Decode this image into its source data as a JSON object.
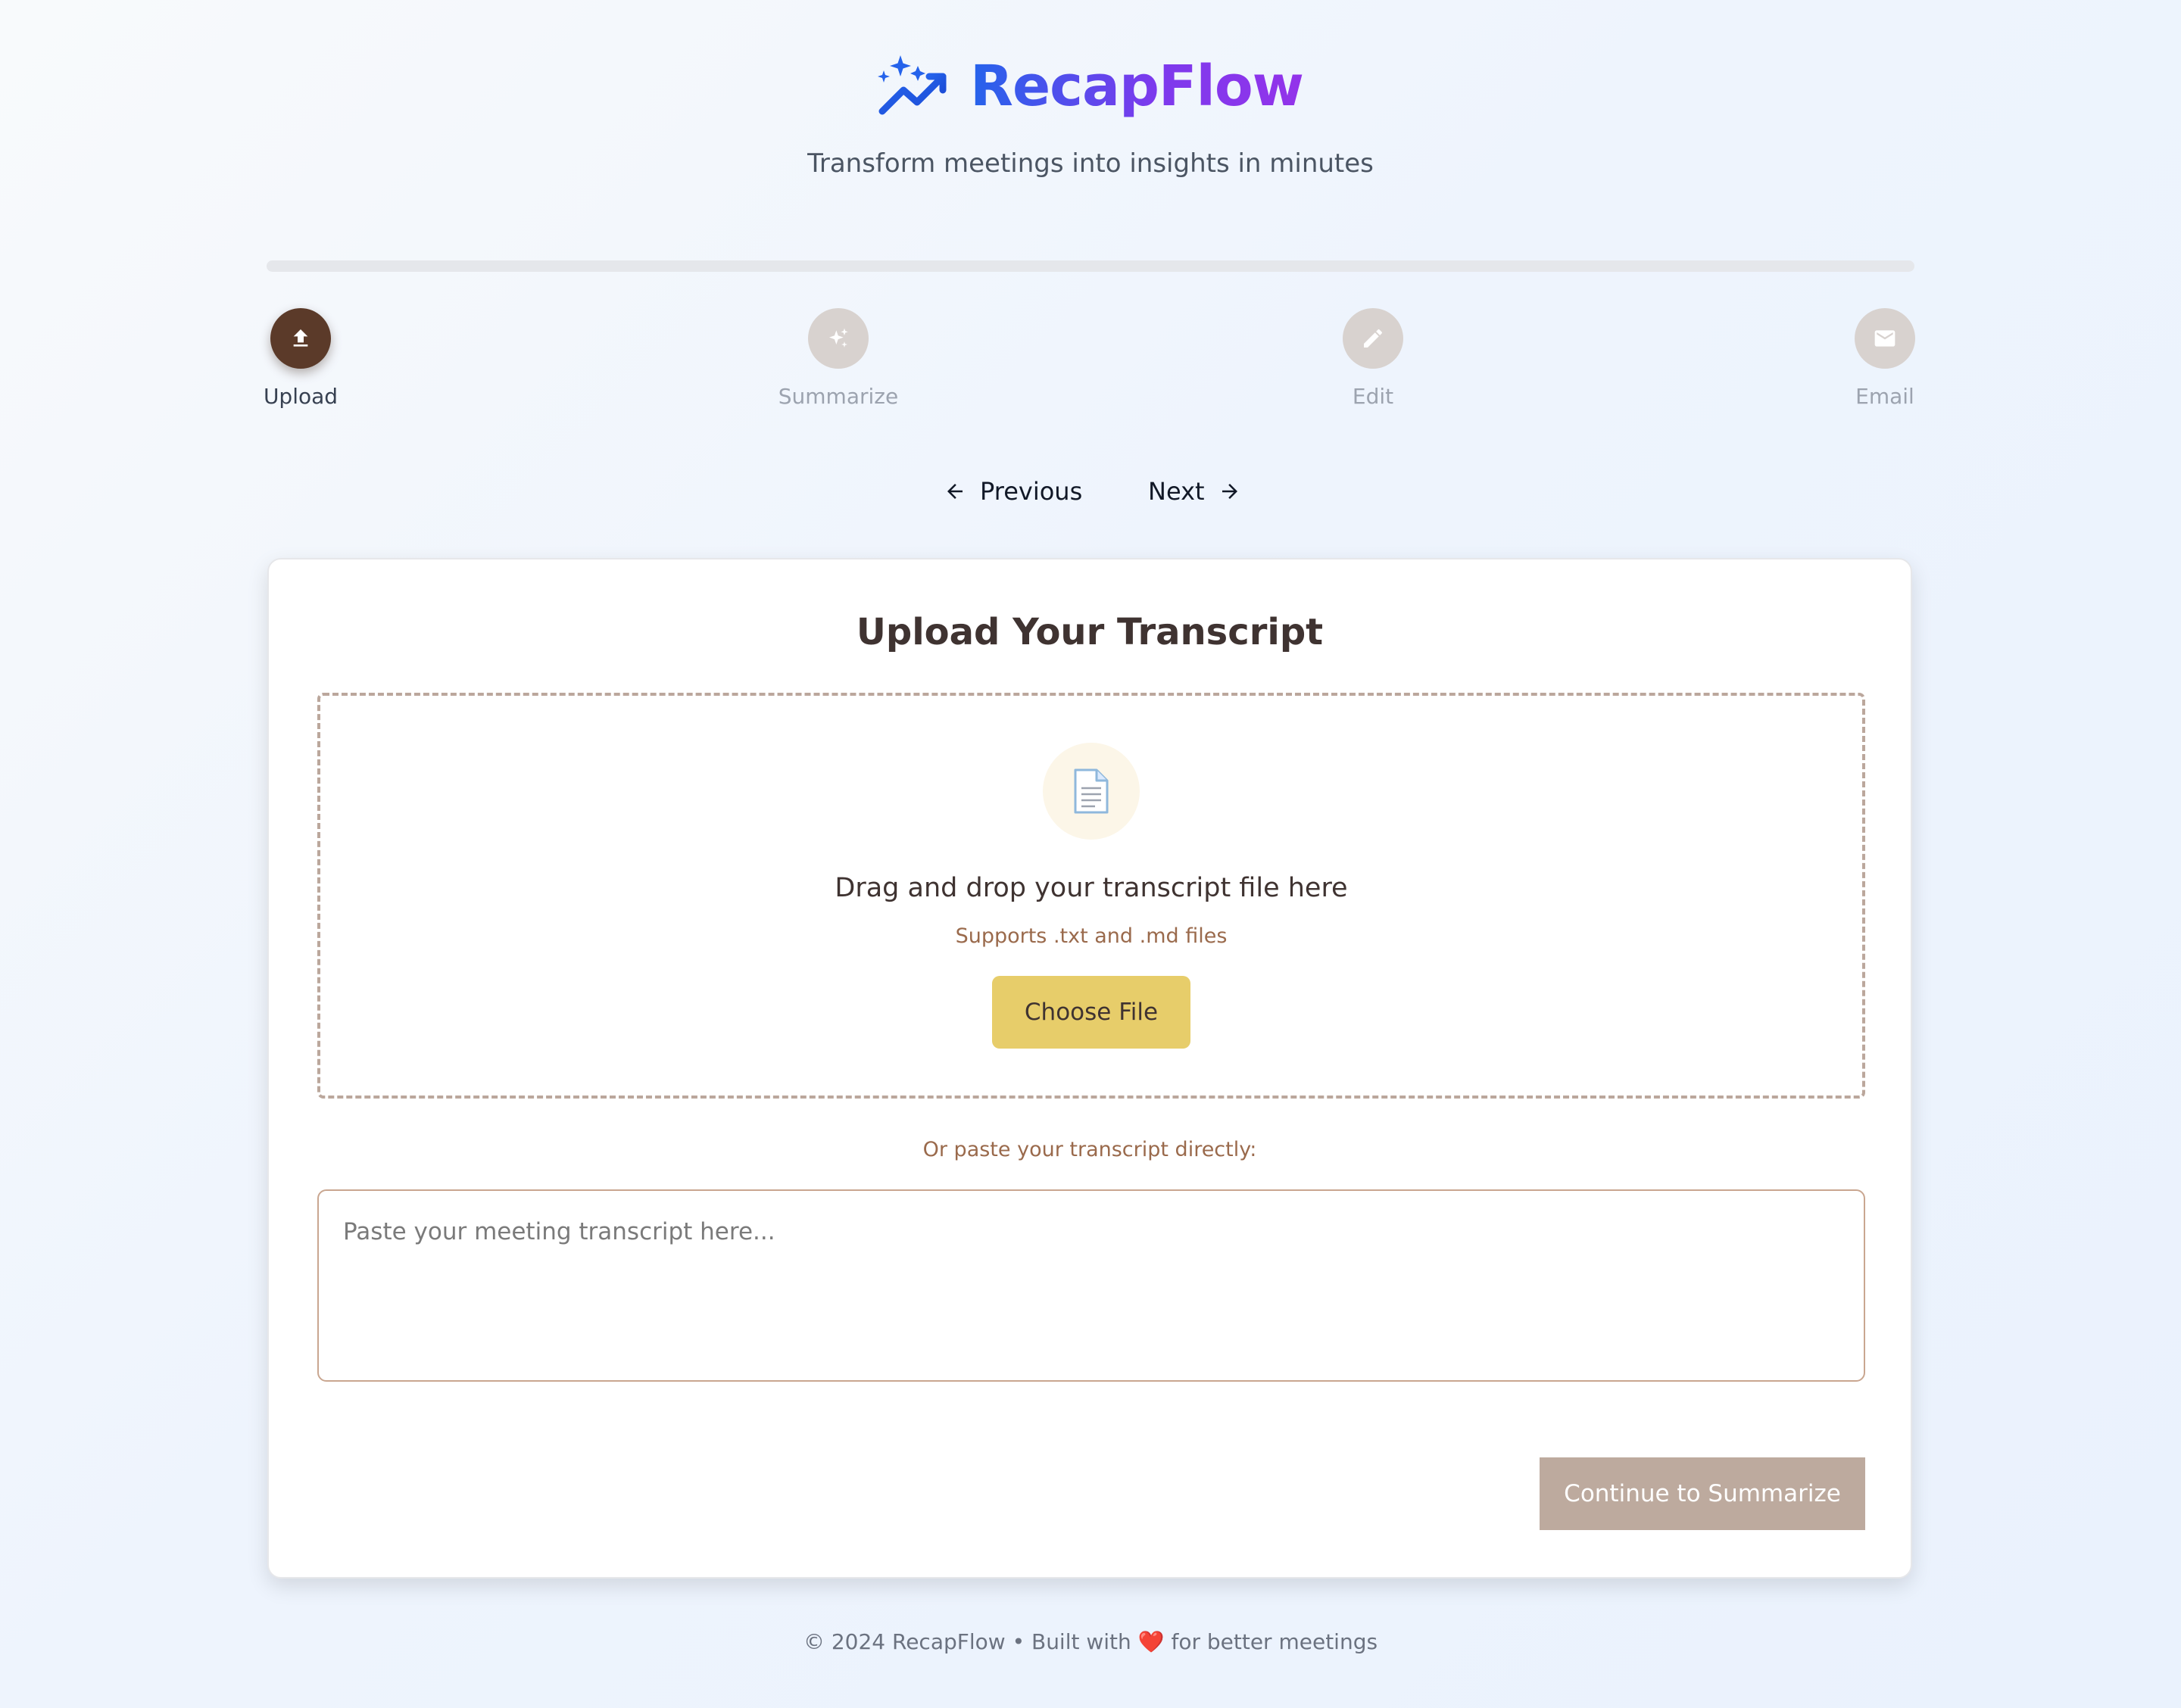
{
  "app": {
    "title": "RecapFlow",
    "tagline": "Transform meetings into insights in minutes"
  },
  "progress": {
    "fraction": 0.0
  },
  "steps": [
    {
      "label": "Upload",
      "icon": "upload-icon",
      "active": true
    },
    {
      "label": "Summarize",
      "icon": "sparkle-icon",
      "active": false
    },
    {
      "label": "Edit",
      "icon": "pencil-icon",
      "active": false
    },
    {
      "label": "Email",
      "icon": "envelope-icon",
      "active": false
    }
  ],
  "nav": {
    "previous_label": "Previous",
    "next_label": "Next"
  },
  "upload": {
    "title": "Upload Your Transcript",
    "drop_text": "Drag and drop your transcript file here",
    "drop_hint": "Supports .txt and .md files",
    "choose_label": "Choose File",
    "paste_label": "Or paste your transcript directly:",
    "placeholder": "Paste your meeting transcript here...",
    "continue_label": "Continue to Summarize"
  },
  "footer": {
    "prefix": "© 2024 RecapFlow • Built with",
    "heart": "❤️",
    "suffix": "for better meetings"
  },
  "colors": {
    "brand_gradient_start": "#2563eb",
    "brand_gradient_end": "#9333ea",
    "active_step": "#5b3a29",
    "inactive_step": "#d8d2cf",
    "choose_button": "#e7cd6a",
    "continue_button": "#bdaa9e",
    "hint_text": "#9a6a4c"
  }
}
